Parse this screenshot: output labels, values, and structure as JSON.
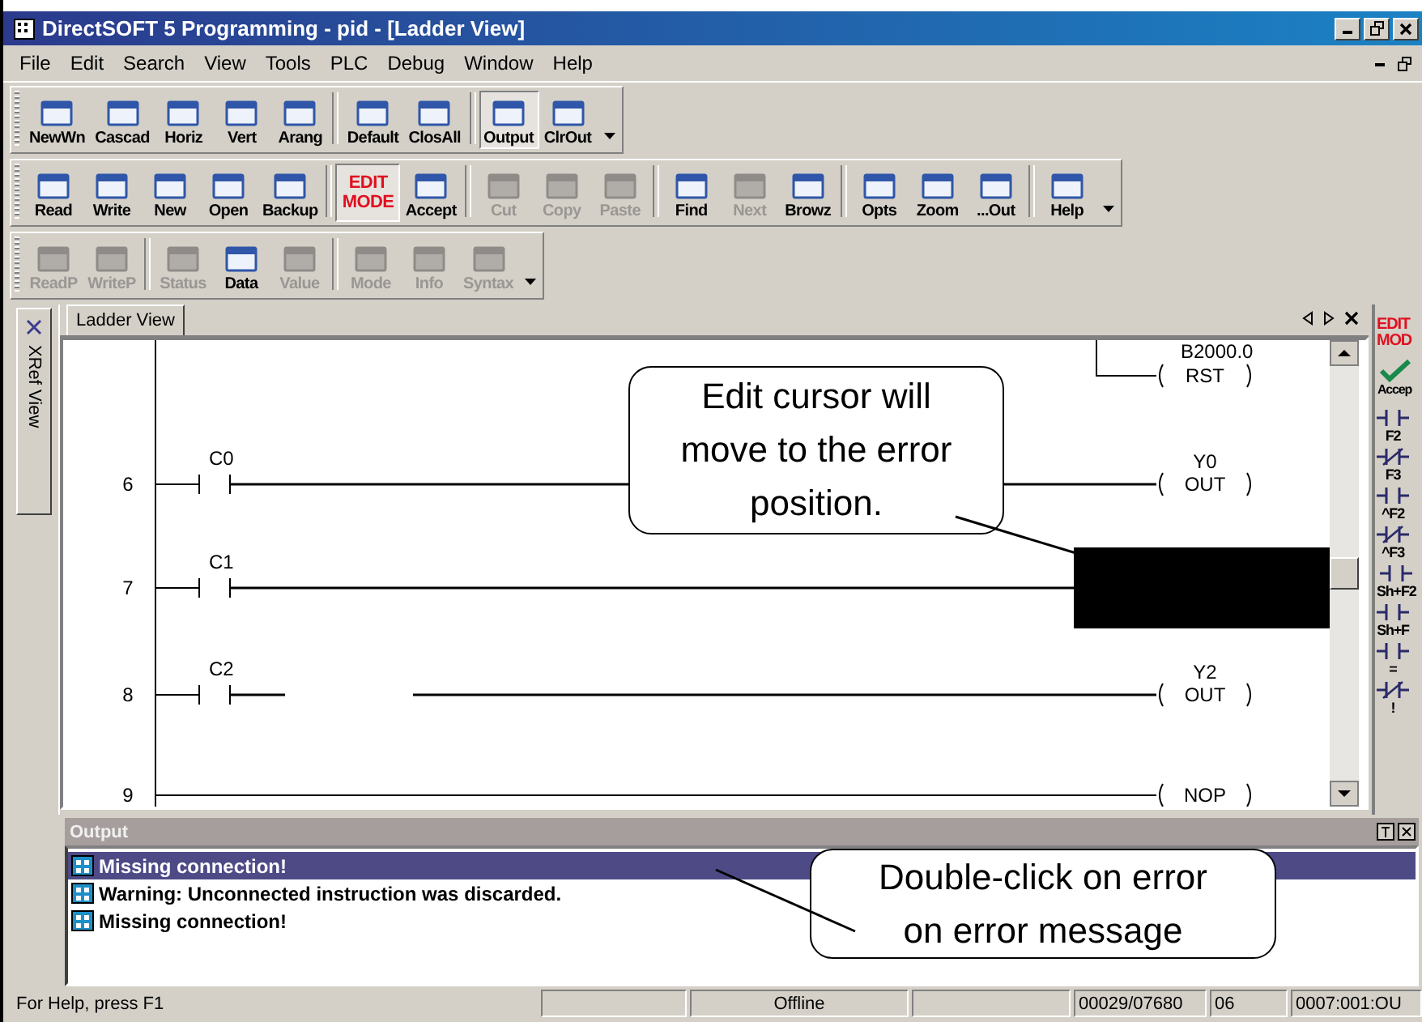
{
  "window": {
    "title": "DirectSOFT 5 Programming - pid - [Ladder View]"
  },
  "menu": [
    {
      "label": "File"
    },
    {
      "label": "Edit"
    },
    {
      "label": "Search"
    },
    {
      "label": "View"
    },
    {
      "label": "Tools"
    },
    {
      "label": "PLC"
    },
    {
      "label": "Debug"
    },
    {
      "label": "Window"
    },
    {
      "label": "Help"
    }
  ],
  "toolbars": [
    {
      "buttons": [
        {
          "label": "NewWn",
          "kind": "icon",
          "disabled": false,
          "pressed": false
        },
        {
          "label": "Cascad",
          "kind": "icon",
          "disabled": false,
          "pressed": false
        },
        {
          "label": "Horiz",
          "kind": "icon",
          "disabled": false,
          "pressed": false
        },
        {
          "label": "Vert",
          "kind": "icon",
          "disabled": false,
          "pressed": false
        },
        {
          "label": "Arang",
          "kind": "icon",
          "disabled": false,
          "pressed": false
        },
        {
          "kind": "separator"
        },
        {
          "label": "Default",
          "kind": "icon",
          "disabled": false,
          "pressed": false
        },
        {
          "label": "ClosAll",
          "kind": "icon",
          "disabled": false,
          "pressed": false
        },
        {
          "kind": "separator"
        },
        {
          "label": "Output",
          "kind": "icon",
          "disabled": false,
          "pressed": true
        },
        {
          "label": "ClrOut",
          "kind": "icon",
          "disabled": false,
          "pressed": false
        }
      ]
    },
    {
      "buttons": [
        {
          "label": "Read",
          "kind": "icon",
          "disabled": false,
          "pressed": false
        },
        {
          "label": "Write",
          "kind": "icon",
          "disabled": false,
          "pressed": false
        },
        {
          "label": "New",
          "kind": "icon",
          "disabled": false,
          "pressed": false
        },
        {
          "label": "Open",
          "kind": "icon",
          "disabled": false,
          "pressed": false
        },
        {
          "label": "Backup",
          "kind": "icon",
          "disabled": false,
          "pressed": false
        },
        {
          "kind": "separator"
        },
        {
          "label": "EDIT MODE",
          "kind": "text",
          "disabled": false,
          "pressed": true
        },
        {
          "label": "Accept",
          "kind": "icon",
          "disabled": false,
          "pressed": false
        },
        {
          "kind": "separator"
        },
        {
          "label": "Cut",
          "kind": "icon",
          "disabled": true,
          "pressed": false
        },
        {
          "label": "Copy",
          "kind": "icon",
          "disabled": true,
          "pressed": false
        },
        {
          "label": "Paste",
          "kind": "icon",
          "disabled": true,
          "pressed": false
        },
        {
          "kind": "separator"
        },
        {
          "label": "Find",
          "kind": "icon",
          "disabled": false,
          "pressed": false
        },
        {
          "label": "Next",
          "kind": "icon",
          "disabled": true,
          "pressed": false
        },
        {
          "label": "Browz",
          "kind": "icon",
          "disabled": false,
          "pressed": false
        },
        {
          "kind": "separator"
        },
        {
          "label": "Opts",
          "kind": "icon",
          "disabled": false,
          "pressed": false
        },
        {
          "label": "Zoom",
          "kind": "icon",
          "disabled": false,
          "pressed": false
        },
        {
          "label": "...Out",
          "kind": "icon",
          "disabled": false,
          "pressed": false
        },
        {
          "kind": "separator"
        },
        {
          "label": "Help",
          "kind": "icon",
          "disabled": false,
          "pressed": false
        }
      ]
    },
    {
      "buttons": [
        {
          "label": "ReadP",
          "kind": "icon",
          "disabled": true,
          "pressed": false
        },
        {
          "label": "WriteP",
          "kind": "icon",
          "disabled": true,
          "pressed": false
        },
        {
          "kind": "separator"
        },
        {
          "label": "Status",
          "kind": "icon",
          "disabled": true,
          "pressed": false
        },
        {
          "label": "Data",
          "kind": "icon",
          "disabled": false,
          "pressed": false
        },
        {
          "label": "Value",
          "kind": "icon",
          "disabled": true,
          "pressed": false
        },
        {
          "kind": "separator"
        },
        {
          "label": "Mode",
          "kind": "icon",
          "disabled": true,
          "pressed": false
        },
        {
          "label": "Info",
          "kind": "icon",
          "disabled": true,
          "pressed": false
        },
        {
          "label": "Syntax",
          "kind": "icon",
          "disabled": true,
          "pressed": false
        }
      ]
    }
  ],
  "side_tab": {
    "label": "XRef View"
  },
  "ladder": {
    "tab": {
      "label": "Ladder View",
      "selected": true
    },
    "top_coil": {
      "address": "B2000.0",
      "instruction": "RST"
    },
    "rungs": [
      {
        "number": "6",
        "contact": "C0",
        "broken": false,
        "coil": {
          "address": "Y0",
          "instruction": "OUT"
        }
      },
      {
        "number": "7",
        "contact": "C1",
        "broken": false,
        "cursor": true
      },
      {
        "number": "8",
        "contact": "C2",
        "broken": true,
        "coil": {
          "address": "Y2",
          "instruction": "OUT"
        }
      },
      {
        "number": "9",
        "coil": {
          "instruction": "NOP"
        }
      }
    ]
  },
  "palette": [
    {
      "label": "EDIT MOD",
      "kind": "mode"
    },
    {
      "label": "Accep",
      "kind": "accept"
    },
    {
      "label": "F2",
      "kind": "contact"
    },
    {
      "label": "F3",
      "kind": "closed"
    },
    {
      "label": "^F2",
      "kind": "contact"
    },
    {
      "label": "^F3",
      "kind": "closed"
    },
    {
      "label": "Sh+F2",
      "kind": "contact"
    },
    {
      "label": "Sh+F",
      "kind": "contact"
    },
    {
      "label": "=",
      "kind": "contact"
    },
    {
      "label": "!",
      "kind": "closed"
    }
  ],
  "output": {
    "title": "Output",
    "messages": [
      {
        "text": "Missing connection!",
        "selected": true
      },
      {
        "text": "Warning:  Unconnected instruction was discarded.",
        "selected": false
      },
      {
        "text": "Missing connection!",
        "selected": false
      }
    ]
  },
  "callouts": [
    {
      "text": "Edit cursor will move to the error position."
    },
    {
      "text": "Double-click on error on error message"
    }
  ],
  "status_bar": {
    "help": "For Help, press F1",
    "mode": "Offline",
    "address": "00029/07680",
    "count": "06",
    "position": "0007:001:OU"
  }
}
